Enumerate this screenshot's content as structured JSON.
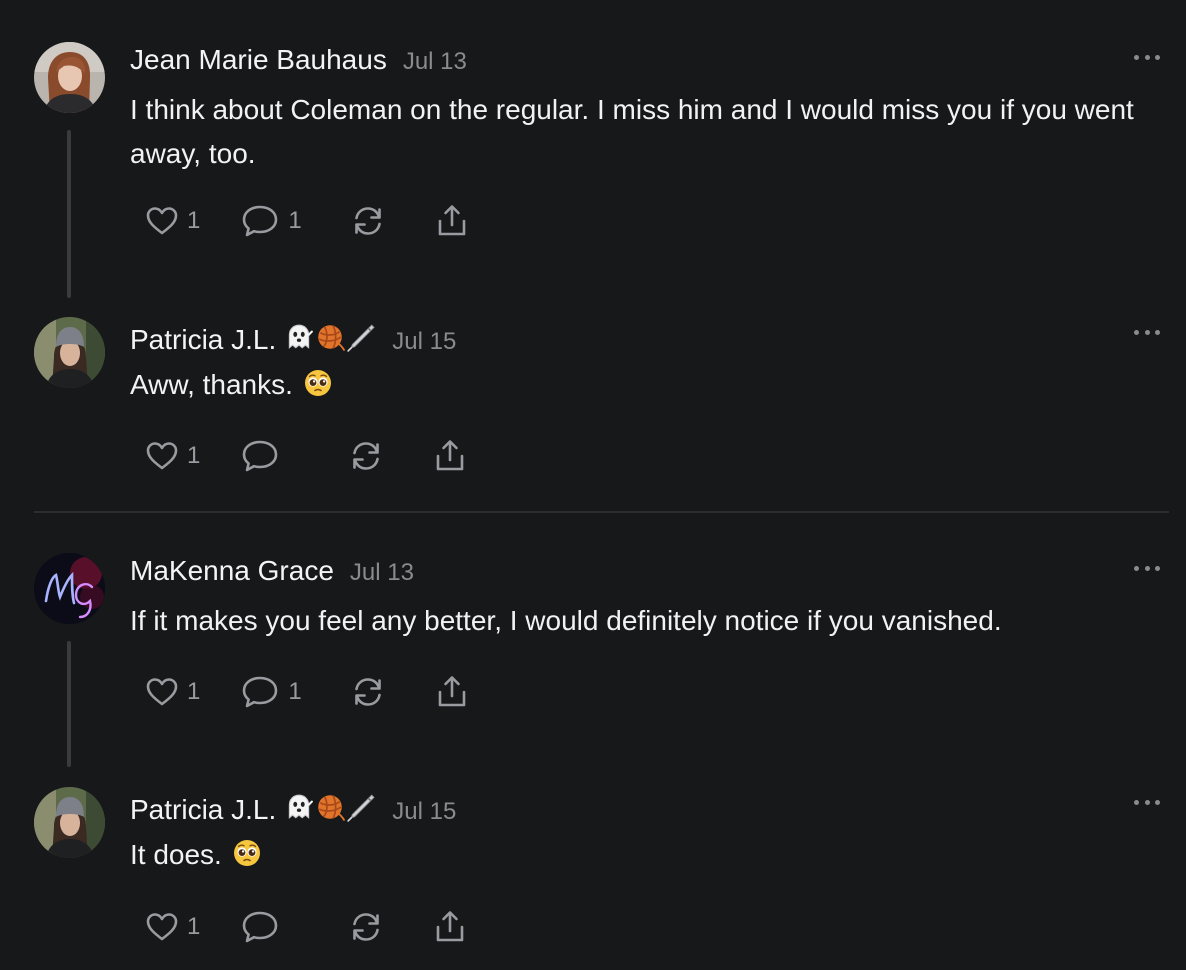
{
  "comments": [
    {
      "author": "Jean Marie Bauhaus",
      "emojis": [],
      "date": "Jul 13",
      "text": "I think about Coleman on the regular. I miss him and I would miss you if you went away, too.",
      "likes": "1",
      "replies": "1",
      "avatar": "woman-red-hair-photo"
    },
    {
      "author": "Patricia J.L.",
      "emojis": [
        "ghost-emoji",
        "yarn-ball-emoji",
        "pen-emoji"
      ],
      "date": "Jul 15",
      "text": "Aww, thanks.",
      "text_emoji": "pleading-face-emoji",
      "likes": "1",
      "replies": "",
      "avatar": "woman-beanie-photo"
    },
    {
      "author": "MaKenna Grace",
      "emojis": [],
      "date": "Jul 13",
      "text": "If it makes you feel any better, I would definitely notice if you vanished.",
      "likes": "1",
      "replies": "1",
      "avatar": "neon-monogram-MG"
    },
    {
      "author": "Patricia J.L.",
      "emojis": [
        "ghost-emoji",
        "yarn-ball-emoji",
        "pen-emoji"
      ],
      "date": "Jul 15",
      "text": "It does.",
      "text_emoji": "pleading-face-emoji",
      "likes": "1",
      "replies": "",
      "avatar": "woman-beanie-photo"
    }
  ],
  "icons": {
    "like": "heart-icon",
    "reply": "comment-bubble-icon",
    "restack": "restack-icon",
    "share": "share-icon",
    "more": "more-options-icon"
  },
  "colors": {
    "background": "#17181a",
    "text": "#f2f2f3",
    "muted": "#8a8b8f",
    "thread_line": "#3a3b3f"
  }
}
